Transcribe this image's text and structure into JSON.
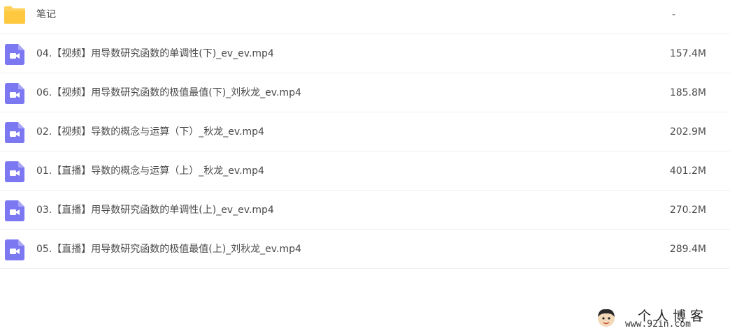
{
  "files": [
    {
      "name": "笔记",
      "size": "-",
      "type": "folder",
      "icon": "folder-icon"
    },
    {
      "name": "04.【视频】用导数研究函数的单调性(下)_ev_ev.mp4",
      "size": "157.4M",
      "type": "video",
      "icon": "video-icon"
    },
    {
      "name": "06.【视频】用导数研究函数的极值最值(下)_刘秋龙_ev.mp4",
      "size": "185.8M",
      "type": "video",
      "icon": "video-icon"
    },
    {
      "name": "02.【视频】导数的概念与运算（下）_秋龙_ev.mp4",
      "size": "202.9M",
      "type": "video",
      "icon": "video-icon"
    },
    {
      "name": "01.【直播】导数的概念与运算（上）_秋龙_ev.mp4",
      "size": "401.2M",
      "type": "video",
      "icon": "video-icon"
    },
    {
      "name": "03.【直播】用导数研究函数的单调性(上)_ev_ev.mp4",
      "size": "270.2M",
      "type": "video",
      "icon": "video-icon"
    },
    {
      "name": "05.【直播】用导数研究函数的极值最值(上)_刘秋龙_ev.mp4",
      "size": "289.4M",
      "type": "video",
      "icon": "video-icon"
    }
  ],
  "watermark": {
    "title": "个人博客",
    "url": "www.92in.com"
  },
  "colors": {
    "folder": "#ffc93f",
    "video": "#7b78f2",
    "text": "#4a4a4a",
    "divider": "#f0f0f0"
  }
}
